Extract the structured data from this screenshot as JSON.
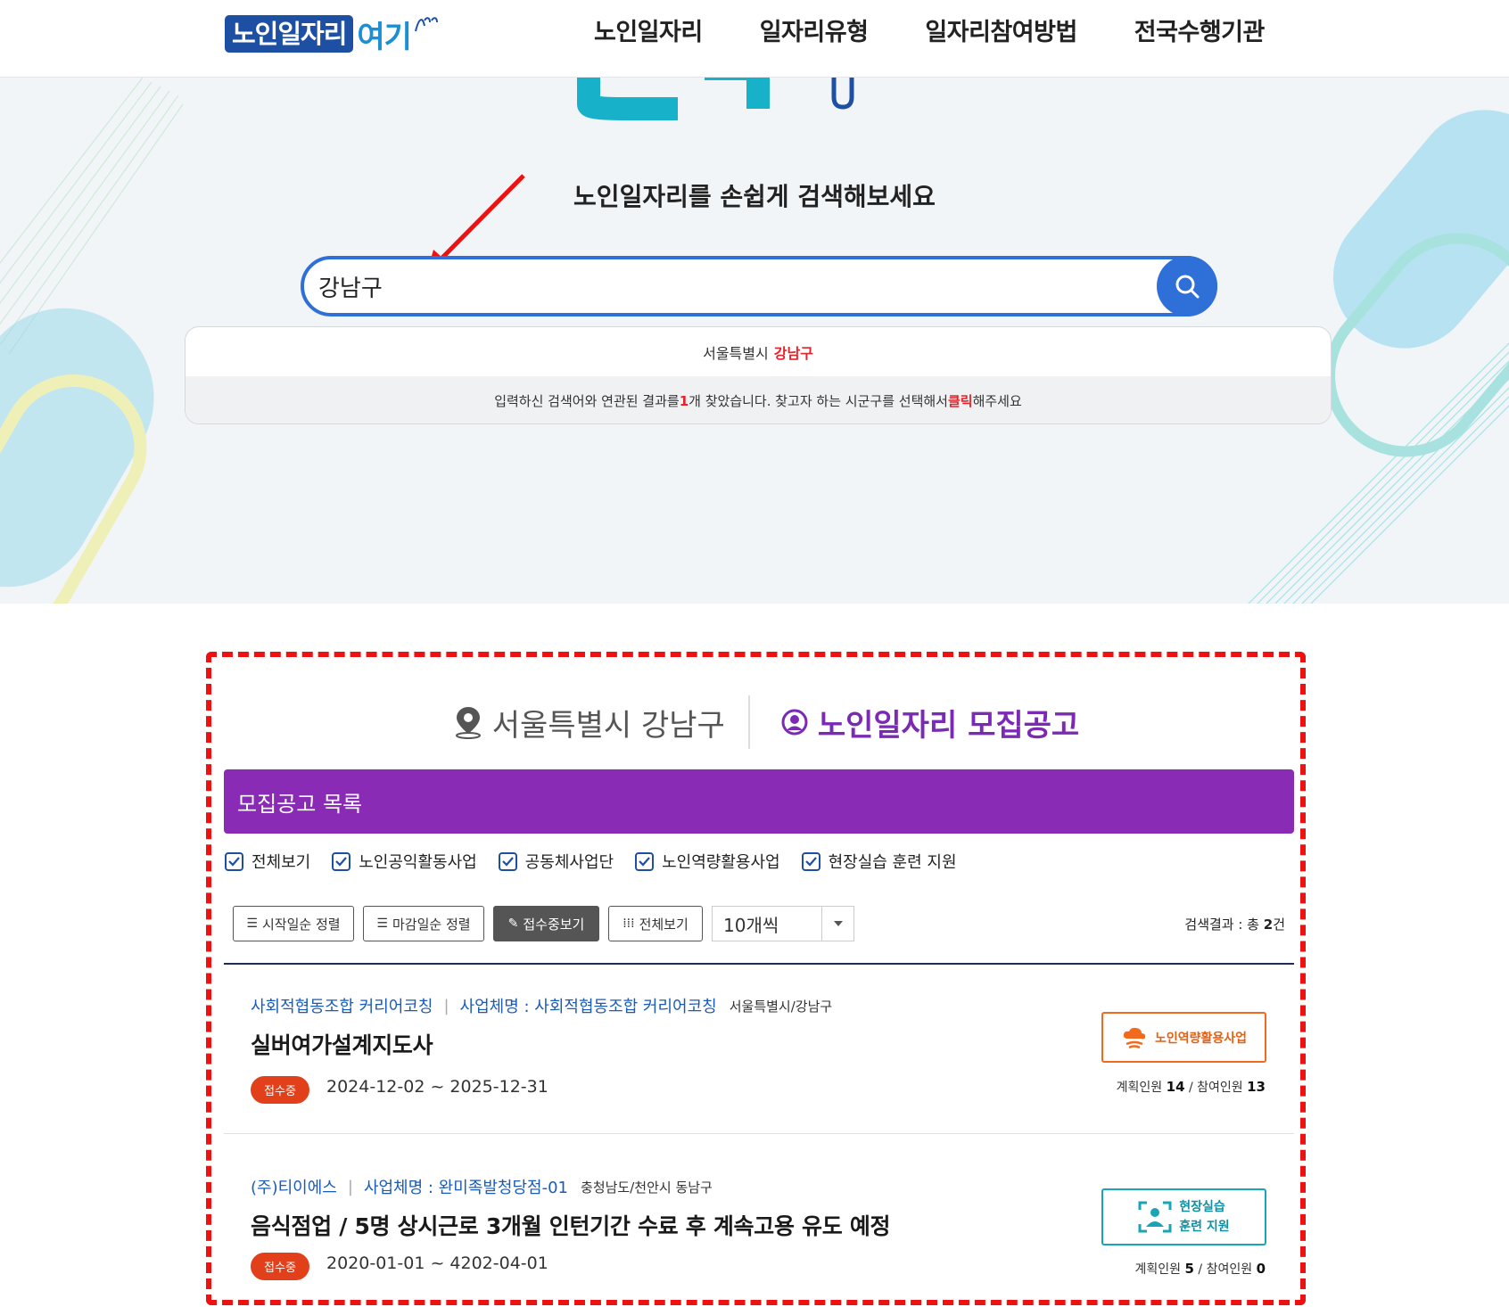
{
  "header": {
    "logo_main": "노인일자리",
    "logo_sub": "여기",
    "nav": [
      "노인일자리",
      "일자리유형",
      "일자리참여방법",
      "전국수행기관"
    ]
  },
  "hero": {
    "title": "노인일자리를 손쉽게 검색해보세요",
    "search_value": "강남구",
    "suggestion": {
      "prefix": "서울특별시",
      "match": "강남구"
    },
    "info": {
      "part1": "입력하신 검색어와 연관된 결과를 ",
      "count": "1",
      "part2": "개 찾았습니다. 찾고자 하는 시군구를 선택해서 ",
      "click": "클릭",
      "part3": "해주세요"
    }
  },
  "section": {
    "location": "서울특별시 강남구",
    "title": "노인일자리 모집공고",
    "list_bar": "모집공고 목록"
  },
  "filters": [
    "전체보기",
    "노인공익활동사업",
    "공동체사업단",
    "노인역량활용사업",
    "현장실습 훈련 지원"
  ],
  "toolbar": {
    "sort_start": "시작일순 정렬",
    "sort_end": "마감일순 정렬",
    "open_only": "접수중보기",
    "view_all": "전체보기",
    "page_size": "10개씩",
    "result_label": "검색결과 : 총 ",
    "result_count": "2",
    "result_unit": "건"
  },
  "listings": [
    {
      "org": "사회적협동조합 커리어코칭",
      "biz_name": "사업체명 : 사회적협동조합 커리어코칭",
      "region": "서울특별시/강남구",
      "title": "실버여가설계지도사",
      "status": "접수중",
      "period": "2024-12-02 ~ 2025-12-31",
      "type": "노인역량활용사업",
      "planned_label": "계획인원",
      "planned": "14",
      "joined_label": "참여인원",
      "joined": "13"
    },
    {
      "org": "(주)티이에스",
      "biz_name": "사업체명 : 완미족발청당점-01",
      "region": "충청남도/천안시 동남구",
      "title": "음식점업 / 5명 상시근로 3개월 인턴기간 수료 후 계속고용 유도 예정",
      "status": "접수중",
      "period": "2020-01-01 ~ 4202-04-01",
      "type_line1": "현장실습",
      "type_line2": "훈련 지원",
      "planned_label": "계획인원",
      "planned": "5",
      "joined_label": "참여인원",
      "joined": "0"
    }
  ],
  "colors": {
    "brand_blue": "#2f6fd8",
    "purple": "#8a2bb5",
    "status_red": "#e2401a",
    "annotation_red": "#ee1111",
    "badge_orange": "#f26a1b",
    "badge_teal": "#1aa5b6"
  },
  "icons": [
    "search-icon",
    "location-pin-icon",
    "user-circle-icon",
    "checkbox-icon",
    "list-icon",
    "pencil-icon",
    "grid-icon",
    "chevron-down-icon",
    "cloud-hand-icon",
    "trainee-icon",
    "annotation-arrow"
  ]
}
